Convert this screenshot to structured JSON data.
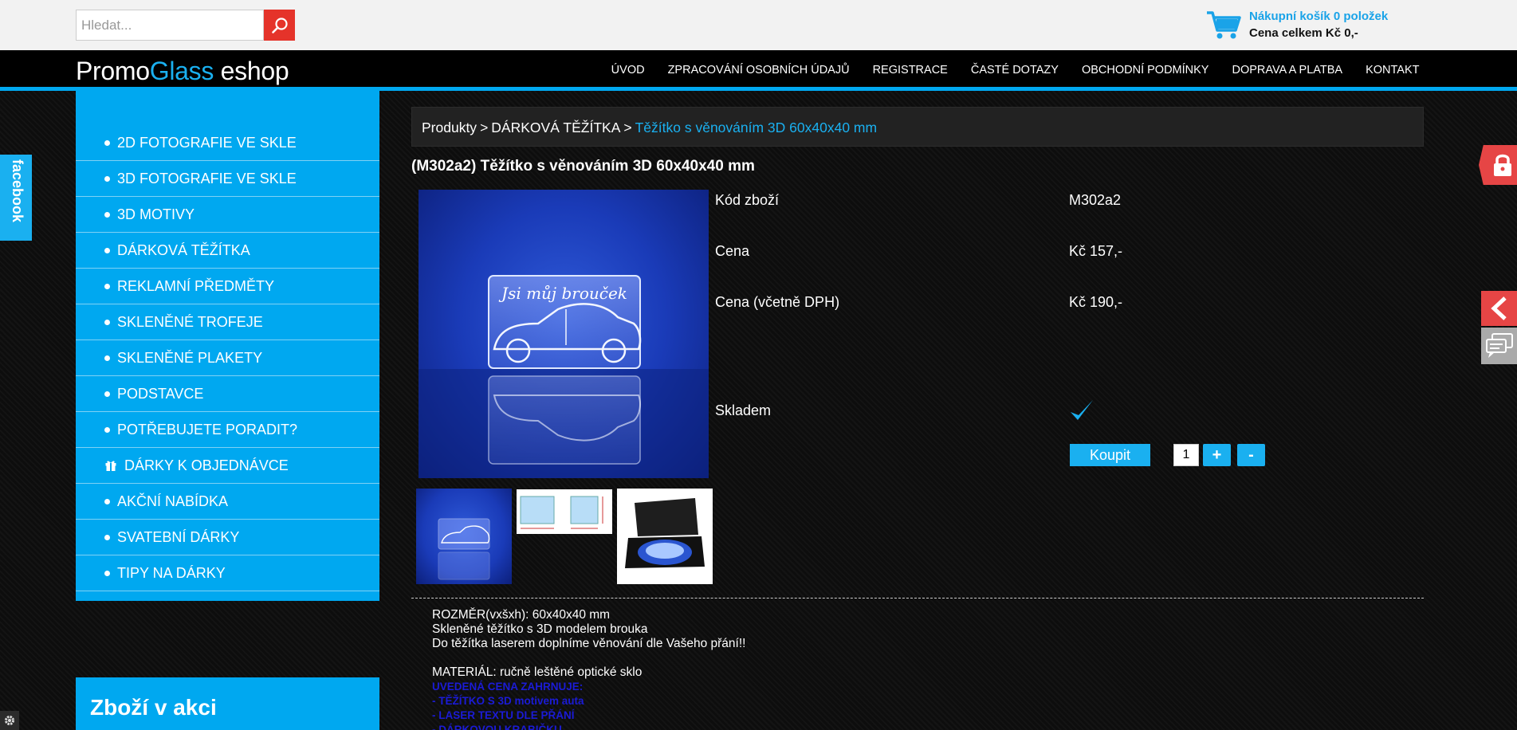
{
  "search": {
    "placeholder": "Hledat..."
  },
  "cart": {
    "count_text": "Nákupní košík 0 položek",
    "total_text": "Cena celkem Kč 0,-"
  },
  "logo": {
    "part1": "Promo",
    "part2": "Glass",
    "part3": " eshop"
  },
  "nav": {
    "items": [
      "ÚVOD",
      "ZPRACOVÁNÍ OSOBNÍCH ÚDAJŮ",
      "REGISTRACE",
      "ČASTÉ DOTAZY",
      "OBCHODNÍ PODMÍNKY",
      "DOPRAVA A PLATBA",
      "KONTAKT"
    ]
  },
  "sidebar": {
    "items": [
      "2D FOTOGRAFIE VE SKLE",
      "3D FOTOGRAFIE VE SKLE",
      "3D MOTIVY",
      "DÁRKOVÁ TĚŽÍTKA",
      "REKLAMNÍ PŘEDMĚTY",
      "SKLENĚNÉ TROFEJE",
      "SKLENĚNÉ PLAKETY",
      "PODSTAVCE",
      "POTŘEBUJETE PORADIT?",
      "DÁRKY K OBJEDNÁVCE",
      "AKČNÍ NABÍDKA",
      "SVATEBNÍ DÁRKY",
      "TIPY NA DÁRKY"
    ]
  },
  "sale_box": {
    "title": "Zboží v akci"
  },
  "breadcrumb": {
    "root": "Produkty",
    "category": "DÁRKOVÁ TĚŽÍTKA",
    "current": "Těžítko s věnováním 3D 60x40x40 mm",
    "separator": ">"
  },
  "product": {
    "title": "(M302a2) Těžítko s věnováním 3D 60x40x40 mm",
    "image_text": "Jsi můj brouček",
    "specs": {
      "code_label": "Kód zboží",
      "code_value": "M302a2",
      "price_label": "Cena",
      "price_value": "Kč 157,-",
      "price_vat_label": "Cena (včetně DPH)",
      "price_vat_value": "Kč 190,-",
      "stock_label": "Skladem"
    },
    "buy_label": "Koupit",
    "quantity": "1",
    "plus_label": "+",
    "minus_label": "-"
  },
  "description": {
    "lines": [
      "ROZMĚR(vxšxh): 60x40x40 mm",
      "Skleněné těžítko s 3D modelem brouka",
      "Do těžítka laserem doplníme věnování dle Vašeho přání!!"
    ],
    "material": "MATERIÁL: ručně leštěné optické sklo",
    "blue_lines": [
      "UVEDENÁ CENA ZAHRNUJE:",
      "- TĚŽÍTKO S 3D motivem auta",
      "- LASER TEXTU DLE PŘÁNÍ",
      "- DÁRKOVOU KRABIČKU"
    ]
  },
  "facebook_tab": {
    "label": "facebook"
  },
  "colors": {
    "accent": "#00a8f0",
    "red": "#e64545",
    "search_red": "#e5332a"
  }
}
